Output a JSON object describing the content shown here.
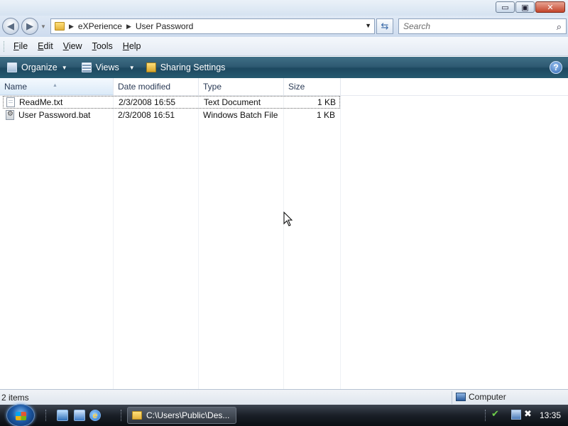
{
  "window": {
    "minimize_label": "▭",
    "maximize_label": "▣",
    "close_label": "✕"
  },
  "address": {
    "breadcrumbs": [
      "eXPerience",
      "User Password"
    ],
    "search_placeholder": "Search"
  },
  "menu": {
    "items": [
      "File",
      "Edit",
      "View",
      "Tools",
      "Help"
    ]
  },
  "commands": {
    "organize": "Organize",
    "views": "Views",
    "sharing": "Sharing Settings",
    "help": "?"
  },
  "list": {
    "columns": [
      "Name",
      "Date modified",
      "Type",
      "Size"
    ],
    "rows": [
      {
        "name": "ReadMe.txt",
        "date": "2/3/2008 16:55",
        "type": "Text Document",
        "size": "1 KB",
        "icon": "text-file-icon"
      },
      {
        "name": "User Password.bat",
        "date": "2/3/2008 16:51",
        "type": "Windows Batch File",
        "size": "1 KB",
        "icon": "batch-file-icon"
      }
    ]
  },
  "status": {
    "item_count": "2 items",
    "location": "Computer"
  },
  "taskbar": {
    "task_label": "C:\\Users\\Public\\Des...",
    "clock": "13:35"
  },
  "colors": {
    "command_bar": "#2f5a72",
    "taskbar": "#1a1f27",
    "selected_header": "#dbeaf8"
  }
}
